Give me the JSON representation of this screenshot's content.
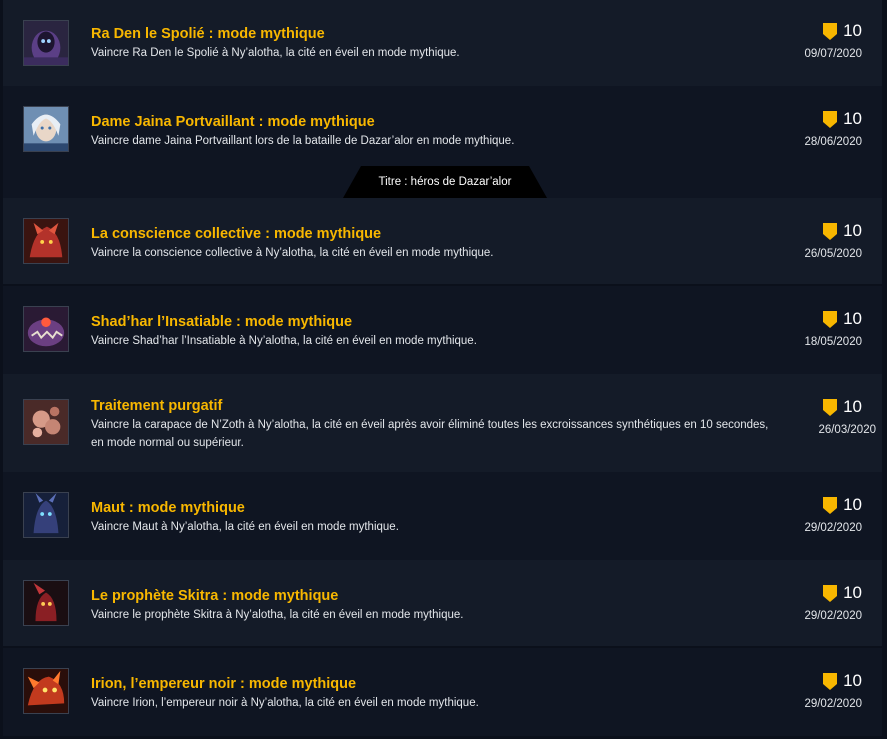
{
  "achievements": [
    {
      "title": "Ra Den le Spolié : mode mythique",
      "description": "Vaincre Ra Den le Spolié à Ny’alotha, la cité en éveil en mode mythique.",
      "points": "10",
      "date": "09/07/2020",
      "icon": "ra-den-portrait-icon"
    },
    {
      "title": "Dame Jaina Portvaillant : mode mythique",
      "description": "Vaincre dame Jaina Portvaillant lors de la bataille de Dazar’alor en mode mythique.",
      "points": "10",
      "date": "28/06/2020",
      "icon": "jaina-portrait-icon",
      "reward": "Titre : héros de Dazar’alor"
    },
    {
      "title": "La conscience collective : mode mythique",
      "description": "Vaincre la conscience collective à Ny’alotha, la cité en éveil en mode mythique.",
      "points": "10",
      "date": "26/05/2020",
      "icon": "hivemind-portrait-icon"
    },
    {
      "title": "Shad’har l’Insatiable : mode mythique",
      "description": "Vaincre Shad’har l’Insatiable à Ny’alotha, la cité en éveil en mode mythique.",
      "points": "10",
      "date": "18/05/2020",
      "icon": "shadhar-portrait-icon"
    },
    {
      "title": "Traitement purgatif",
      "description": "Vaincre la carapace de N’Zoth à Ny’alotha, la cité en éveil après avoir éliminé toutes les excroissances synthétiques en 10 secondes, en mode normal ou supérieur.",
      "points": "10",
      "date": "26/03/2020",
      "icon": "carapace-portrait-icon"
    },
    {
      "title": "Maut : mode mythique",
      "description": "Vaincre Maut à Ny’alotha, la cité en éveil en mode mythique.",
      "points": "10",
      "date": "29/02/2020",
      "icon": "maut-portrait-icon"
    },
    {
      "title": "Le prophète Skitra : mode mythique",
      "description": "Vaincre le prophète Skitra à Ny’alotha, la cité en éveil en mode mythique.",
      "points": "10",
      "date": "29/02/2020",
      "icon": "skitra-portrait-icon"
    },
    {
      "title": "Irion, l’empereur noir : mode mythique",
      "description": "Vaincre Irion, l’empereur noir à Ny’alotha, la cité en éveil en mode mythique.",
      "points": "10",
      "date": "29/02/2020",
      "icon": "wrathion-portrait-icon"
    }
  ],
  "colors": {
    "title": "#f8b700",
    "shield": "#f8b700",
    "row_background": "#141b28",
    "row_background_alt": "#0f1522",
    "page_background": "#0b101b"
  }
}
